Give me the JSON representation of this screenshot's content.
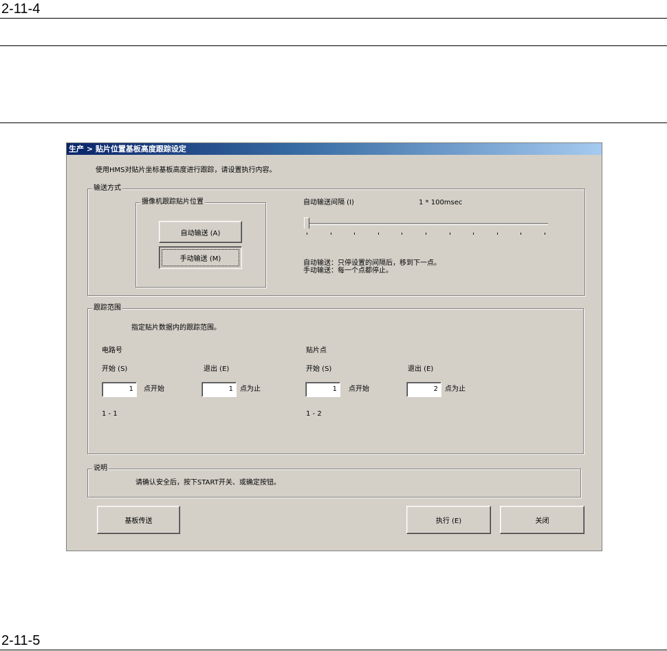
{
  "page": {
    "heading_top": "2-11-4",
    "heading_bottom": "2-11-5"
  },
  "dialog": {
    "title": "生产 > 贴片位置基板高度跟踪设定",
    "instruction": "使用HMS对贴片坐标基板高度进行跟踪，请设置执行内容。",
    "transport": {
      "legend": "输送方式",
      "camera_group_legend": "摄像机跟踪贴片位置",
      "auto_button": "自动输送 (A)",
      "manual_button": "手动输送 (M)",
      "interval_label": "自动输送间隔 (I)",
      "interval_value": "1 * 100msec",
      "slider_value": 1,
      "slider_ticks": 11,
      "desc_line1": "自动输送：只停设置的间隔后，移到下一点。",
      "desc_line2": "手动输送：每一个点都停止。"
    },
    "range": {
      "legend": "跟踪范围",
      "hint": "指定贴片数据内的跟踪范围。",
      "circuit": {
        "label": "电路号",
        "start_label": "开始 (S)",
        "end_label": "退出 (E)",
        "start_value": "1",
        "start_suffix": "点开始",
        "end_value": "1",
        "end_suffix": "点为止",
        "range_text": "1 - 1"
      },
      "points": {
        "label": "贴片点",
        "start_label": "开始 (S)",
        "end_label": "退出 (E)",
        "start_value": "1",
        "start_suffix": "点开始",
        "end_value": "2",
        "end_suffix": "点为止",
        "range_text": "1 - 2"
      }
    },
    "note": {
      "legend": "说明",
      "text": "请确认安全后，按下START开关、或确定按钮。"
    },
    "buttons": {
      "board_transfer": "基板传送",
      "execute": "执行 (E)",
      "close": "关闭"
    }
  }
}
